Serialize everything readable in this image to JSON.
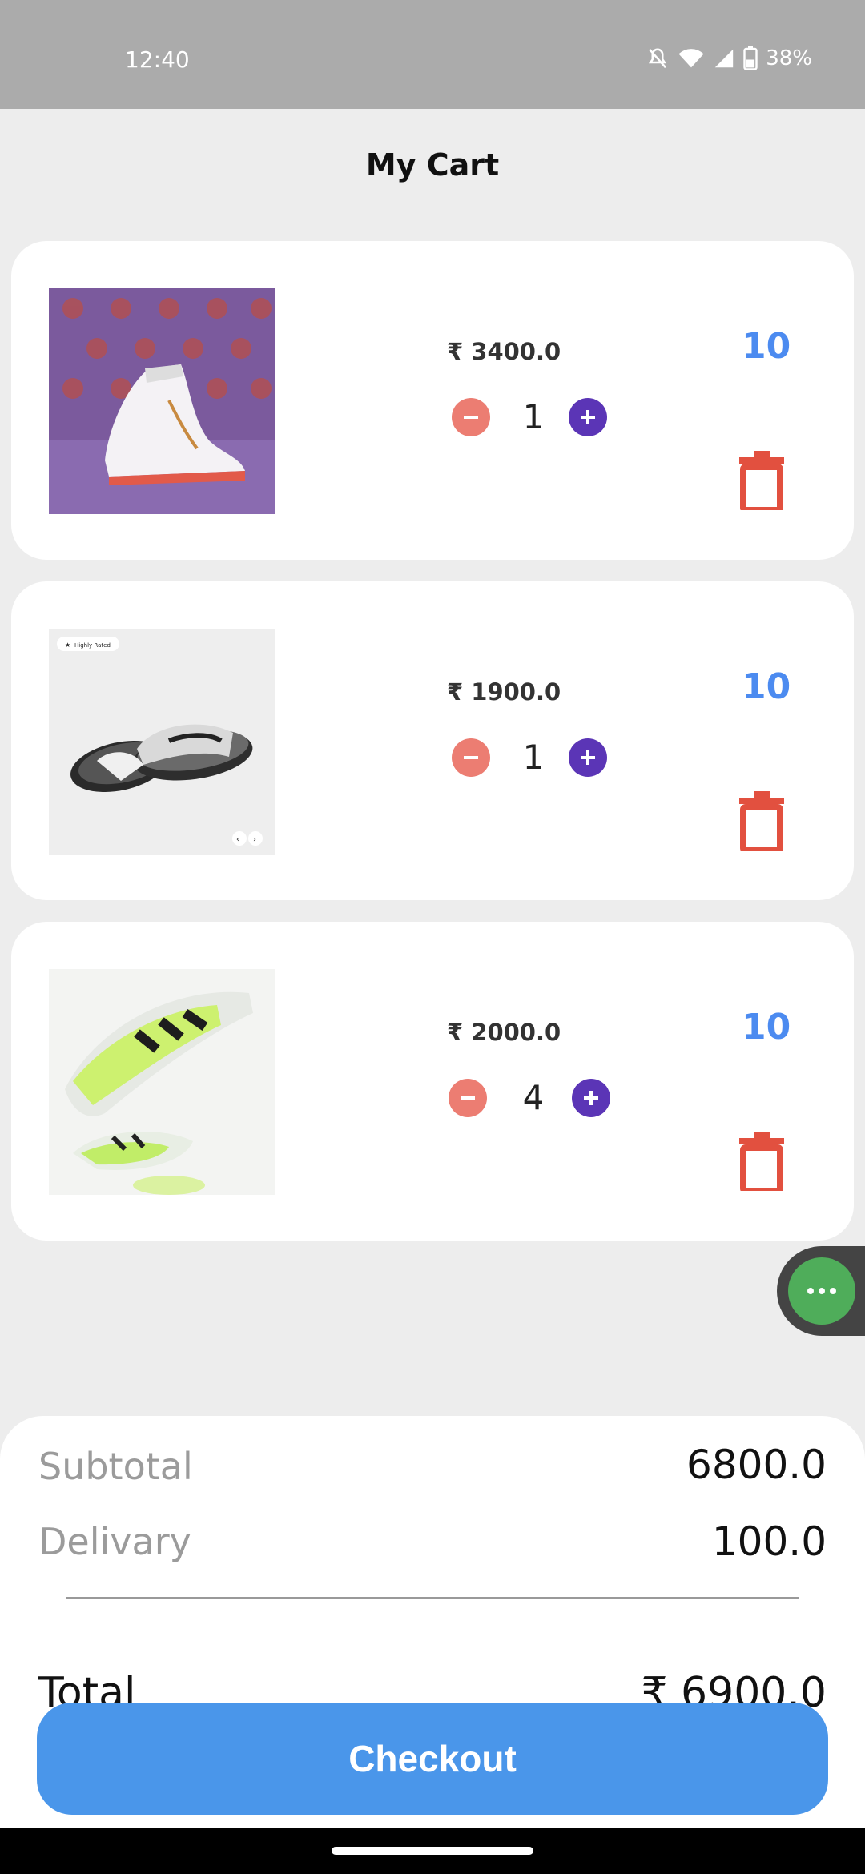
{
  "status_bar": {
    "time": "12:40",
    "battery": "38%"
  },
  "page": {
    "title": "My Cart"
  },
  "cart": {
    "items": [
      {
        "price": "₹ 3400.0",
        "quantity": "1",
        "stock": "10"
      },
      {
        "price": "₹ 1900.0",
        "quantity": "1",
        "stock": "10"
      },
      {
        "price": "₹ 2000.0",
        "quantity": "4",
        "stock": "10"
      }
    ]
  },
  "product_images": {
    "item2_badge": "Highly Rated"
  },
  "summary": {
    "subtotal_label": "Subtotal",
    "subtotal_value": "6800.0",
    "delivery_label": "Delivary",
    "delivery_value": "100.0",
    "total_label": "Total",
    "total_value": "₹ 6900.0"
  },
  "checkout": {
    "label": "Checkout"
  },
  "colors": {
    "accent_blue": "#4a96ea",
    "stock_blue": "#4c8bf0",
    "minus_red": "#ec7d72",
    "plus_purple": "#5b35b6",
    "trash_red": "#e2503f",
    "fab_green": "#4fad5a"
  },
  "icons": [
    "bell-off-icon",
    "wifi-icon",
    "signal-icon",
    "battery-icon",
    "minus-icon",
    "plus-icon",
    "trash-icon",
    "more-icon"
  ]
}
